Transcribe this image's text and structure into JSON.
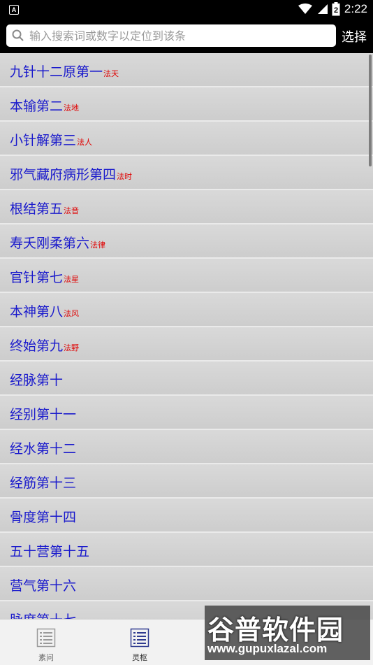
{
  "status_bar": {
    "left_icon_text": "A",
    "battery_level": "2",
    "time": "2:22"
  },
  "search": {
    "placeholder": "输入搜索词或数字以定位到该条",
    "value": "",
    "select_label": "选择"
  },
  "chapters": [
    {
      "title": "九针十二原第一",
      "tag": "法天"
    },
    {
      "title": "本输第二",
      "tag": "法地"
    },
    {
      "title": "小针解第三",
      "tag": "法人"
    },
    {
      "title": "邪气藏府病形第四",
      "tag": "法时"
    },
    {
      "title": "根结第五",
      "tag": "法音"
    },
    {
      "title": "寿夭刚柔第六",
      "tag": "法律"
    },
    {
      "title": "官针第七",
      "tag": "法星"
    },
    {
      "title": "本神第八",
      "tag": "法风"
    },
    {
      "title": "终始第九",
      "tag": "法野"
    },
    {
      "title": "经脉第十",
      "tag": ""
    },
    {
      "title": "经别第十一",
      "tag": ""
    },
    {
      "title": "经水第十二",
      "tag": ""
    },
    {
      "title": "经筋第十三",
      "tag": ""
    },
    {
      "title": "骨度第十四",
      "tag": ""
    },
    {
      "title": "五十营第十五",
      "tag": ""
    },
    {
      "title": "营气第十六",
      "tag": ""
    },
    {
      "title": "脉度第十七",
      "tag": ""
    }
  ],
  "bottom_nav": {
    "tabs": [
      {
        "label": "素问"
      },
      {
        "label": "灵枢"
      }
    ]
  },
  "watermark": {
    "title": "谷普软件园",
    "url": "www.gupuxlazal.com"
  },
  "colors": {
    "chapter_title": "#1a1acc",
    "chapter_tag": "#e00000",
    "active_tab": "#2f3a8f"
  }
}
